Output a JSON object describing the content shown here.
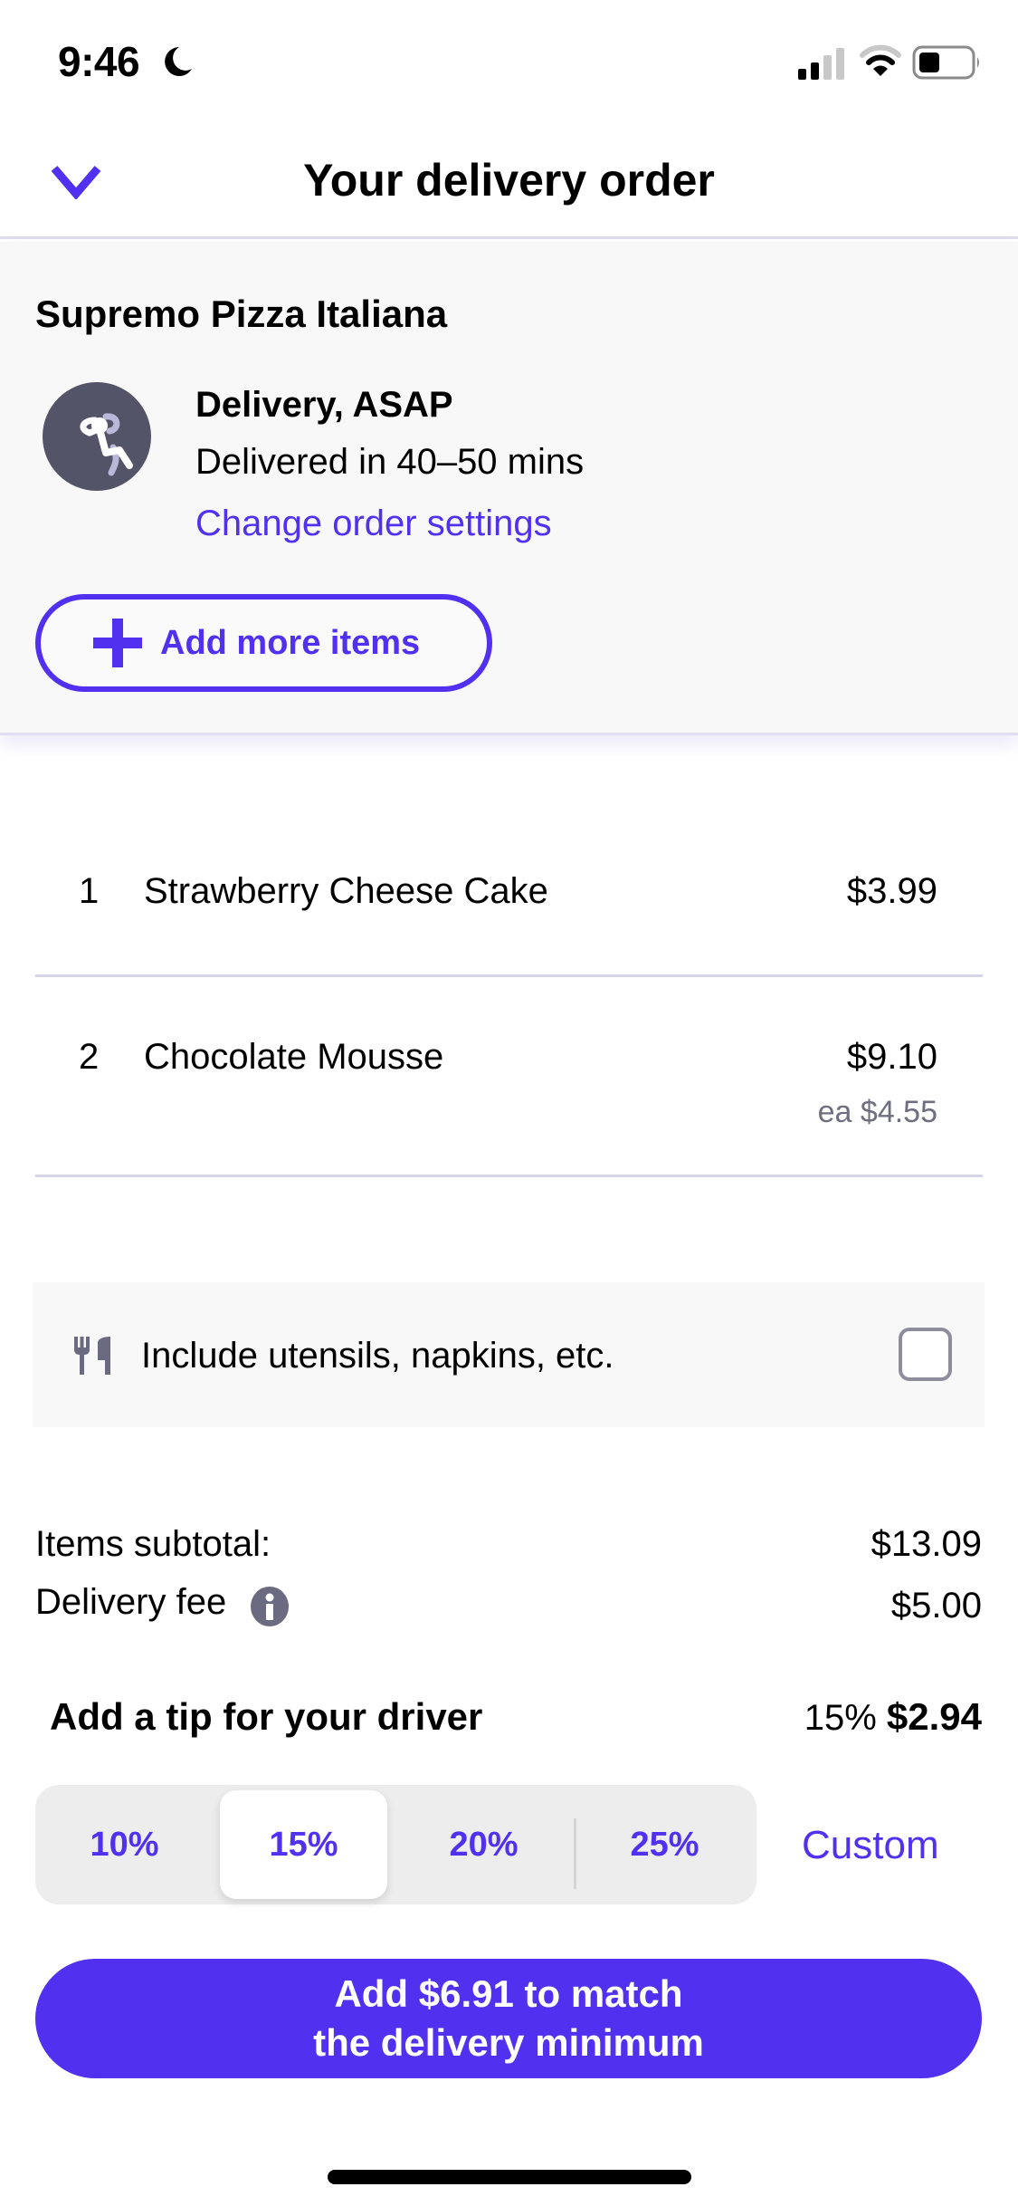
{
  "status_bar": {
    "time": "9:46",
    "focus_icon": "moon-icon",
    "signal_bars": 2,
    "signal_bars_total": 4,
    "wifi_arcs": 2,
    "wifi_arcs_total": 3,
    "battery_level": 0.35
  },
  "header": {
    "back_icon": "chevron-down-icon",
    "title": "Your delivery order"
  },
  "restaurant": {
    "name": "Supremo Pizza Italiana",
    "avatar_icon": "relaxing-person-icon",
    "delivery_type": "Delivery, ASAP",
    "delivery_time": "Delivered in 40–50 mins",
    "change_link": "Change order settings",
    "add_more_label": "Add more items"
  },
  "items": [
    {
      "qty": "1",
      "name": "Strawberry Cheese Cake",
      "price": "$3.99",
      "each": ""
    },
    {
      "qty": "2",
      "name": "Chocolate Mousse",
      "price": "$9.10",
      "each": "ea $4.55"
    }
  ],
  "utensils": {
    "icon": "utensils-icon",
    "label": "Include utensils, napkins, etc.",
    "checked": false
  },
  "totals": {
    "subtotal_label": "Items subtotal:",
    "subtotal_value": "$13.09",
    "delivery_fee_label": "Delivery fee",
    "delivery_fee_value": "$5.00",
    "info_icon": "info-icon"
  },
  "tip": {
    "title": "Add a tip for your driver",
    "selected_percent": "15%",
    "selected_amount": "$2.94",
    "options": [
      {
        "label": "10%",
        "selected": false
      },
      {
        "label": "15%",
        "selected": true
      },
      {
        "label": "20%",
        "selected": false
      },
      {
        "label": "25%",
        "selected": false
      }
    ],
    "custom_label": "Custom"
  },
  "cta": {
    "line1": "Add $6.91 to match",
    "line2": "the delivery minimum"
  },
  "colors": {
    "accent": "#5230ef",
    "section_bg": "#f8f8f8",
    "avatar_bg": "#545469",
    "muted_text": "#6e6e80"
  }
}
